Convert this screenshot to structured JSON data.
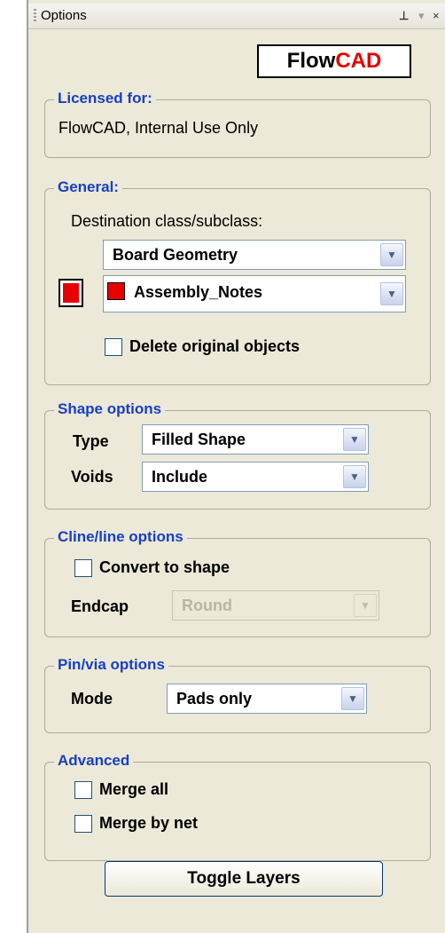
{
  "window": {
    "title": "Options",
    "pin_icon": "pin-icon",
    "dropdown_icon": "chevron-down-icon",
    "close_icon": "close-icon"
  },
  "logo": {
    "part1": "Flow",
    "part2": "CAD",
    "accent_color": "#e00000"
  },
  "licensed": {
    "legend": "Licensed for:",
    "text": "FlowCAD, Internal Use Only"
  },
  "general": {
    "legend": "General:",
    "dest_label": "Destination class/subclass:",
    "class_value": "Board Geometry",
    "subclass_value": "Assembly_Notes",
    "color": "#e80000",
    "delete_label": "Delete original objects",
    "delete_checked": false
  },
  "shape": {
    "legend": "Shape options",
    "type_label": "Type",
    "type_value": "Filled Shape",
    "voids_label": "Voids",
    "voids_value": "Include"
  },
  "cline": {
    "legend": "Cline/line options",
    "convert_label": "Convert to shape",
    "convert_checked": false,
    "endcap_label": "Endcap",
    "endcap_value": "Round"
  },
  "pinvia": {
    "legend": "Pin/via options",
    "mode_label": "Mode",
    "mode_value": "Pads only"
  },
  "advanced": {
    "legend": "Advanced",
    "merge_all_label": "Merge all",
    "merge_all_checked": false,
    "merge_net_label": "Merge by net",
    "merge_net_checked": false
  },
  "toggle_button": "Toggle Layers"
}
